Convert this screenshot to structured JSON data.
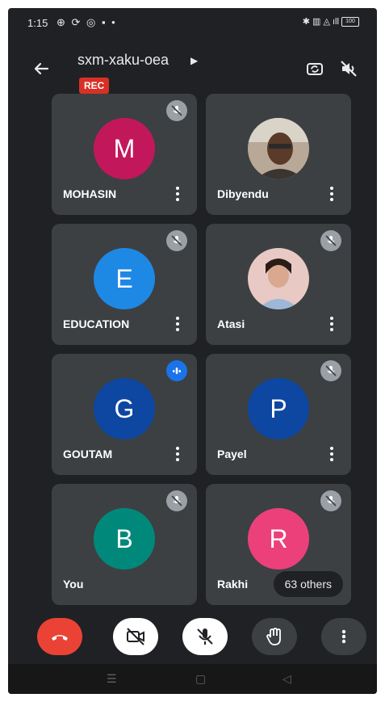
{
  "status_bar": {
    "time": "1:15",
    "battery": "100"
  },
  "meeting": {
    "code": "sxm-xaku-oea",
    "rec_label": "REC"
  },
  "participants": [
    {
      "name": "MOHASIN",
      "initial": "M",
      "color": "#c2185b",
      "mic": "muted"
    },
    {
      "name": "Dibyendu",
      "initial": "",
      "color": "",
      "mic": "none",
      "photo": true
    },
    {
      "name": "EDUCATION",
      "initial": "E",
      "color": "#1e88e5",
      "mic": "muted"
    },
    {
      "name": "Atasi",
      "initial": "",
      "color": "",
      "mic": "muted",
      "photo": true
    },
    {
      "name": "GOUTAM",
      "initial": "G",
      "color": "#0d47a1",
      "mic": "speaking"
    },
    {
      "name": "Payel",
      "initial": "P",
      "color": "#0d47a1",
      "mic": "muted"
    },
    {
      "name": "You",
      "initial": "B",
      "color": "#00897b",
      "mic": "muted"
    },
    {
      "name": "Rakhi",
      "initial": "R",
      "color": "#ec407a",
      "mic": "muted"
    }
  ],
  "others_chip": "63 others",
  "colors": {
    "background": "#202124",
    "tile": "#3c4043",
    "end_call": "#ea4335",
    "speaking": "#1a73e8"
  },
  "controls": [
    {
      "id": "end-call",
      "icon": "phone-hangup-icon"
    },
    {
      "id": "camera",
      "icon": "camera-off-icon"
    },
    {
      "id": "mic",
      "icon": "mic-off-icon"
    },
    {
      "id": "raise-hand",
      "icon": "hand-icon"
    },
    {
      "id": "more",
      "icon": "more-vert-icon"
    }
  ]
}
